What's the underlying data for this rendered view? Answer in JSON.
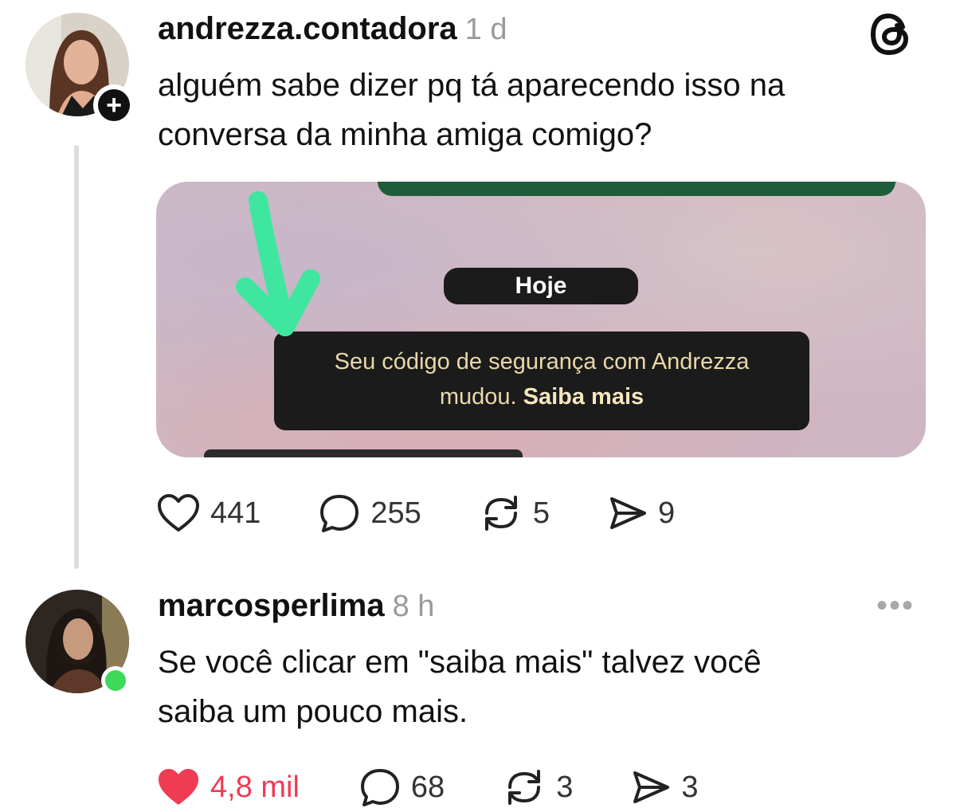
{
  "colors": {
    "accent_like": "#ef3b53",
    "online": "#3cd95a",
    "mint_arrow": "#3fe6a0",
    "whatsapp_green": "#1f5c3a"
  },
  "post": {
    "username": "andrezza.contadora",
    "time": "1 d",
    "text_line1": "alguém sabe dizer pq tá aparecendo isso na",
    "text_line2": "conversa da minha amiga comigo?",
    "app_icon": "threads-logo-icon",
    "follow_icon": "plus-icon",
    "media": {
      "date_pill": "Hoje",
      "security_line1": "Seu código de segurança com Andrezza",
      "security_line2_prefix": "mudou. ",
      "security_link": "Saiba mais",
      "annotation_icon": "hand-drawn-arrow-icon"
    },
    "actions": {
      "likes": "441",
      "comments": "255",
      "reposts": "5",
      "shares": "9"
    }
  },
  "reply": {
    "username": "marcosperlima",
    "time": "8 h",
    "text_line1": "Se você clicar em \"saiba mais\" talvez você",
    "text_line2": "saiba um pouco mais.",
    "more_icon": "more-dots-icon",
    "online_icon": "online-dot-icon",
    "actions": {
      "likes": "4,8 mil",
      "liked": true,
      "comments": "68",
      "reposts": "3",
      "shares": "3"
    }
  }
}
